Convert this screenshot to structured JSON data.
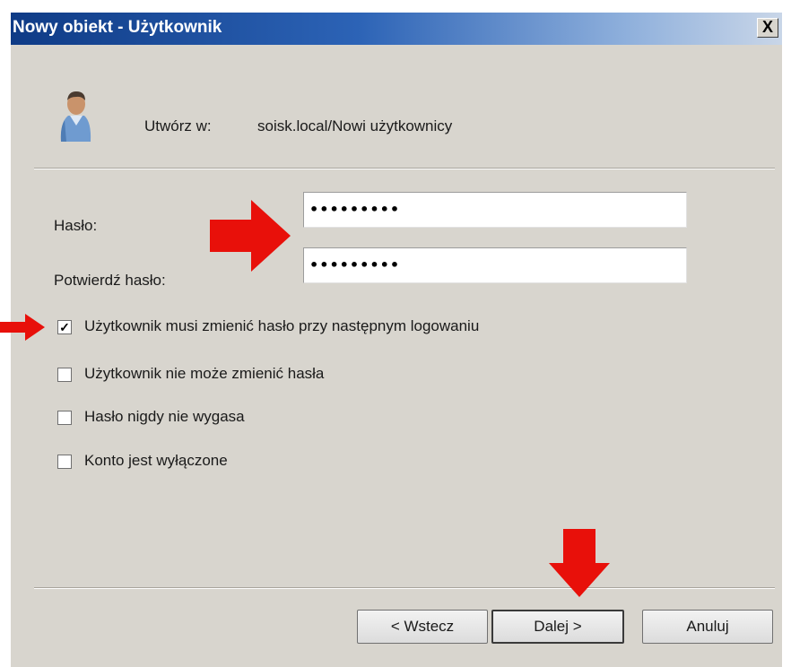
{
  "window": {
    "title": "Nowy obiekt - Użytkownik",
    "close_symbol": "X"
  },
  "header": {
    "icon": "user-icon",
    "create_label": "Utwórz w:",
    "create_path": "soisk.local/Nowi użytkownicy"
  },
  "form": {
    "password_label": "Hasło:",
    "password_value": "•••••••••",
    "confirm_label": "Potwierdź hasło:",
    "confirm_value": "•••••••••"
  },
  "options": [
    {
      "label": "Użytkownik musi zmienić hasło przy następnym logowaniu",
      "checked": true
    },
    {
      "label": "Użytkownik nie może zmienić hasła",
      "checked": false
    },
    {
      "label": "Hasło nigdy nie wygasa",
      "checked": false
    },
    {
      "label": "Konto jest wyłączone",
      "checked": false
    }
  ],
  "buttons": {
    "back": "< Wstecz",
    "next": "Dalej >",
    "cancel": "Anuluj"
  },
  "annotations": {
    "arrow_color": "#e8100a"
  }
}
